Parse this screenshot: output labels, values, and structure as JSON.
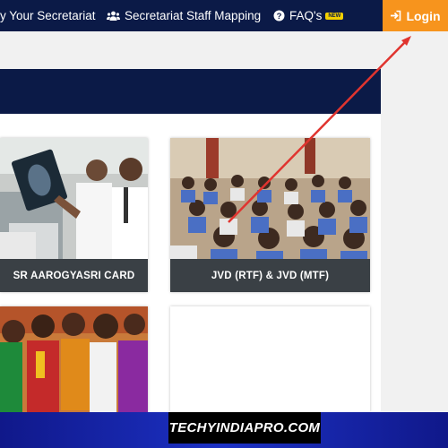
{
  "nav": {
    "item_1": "y Your Secretariat",
    "item_2": "Secretariat Staff Mapping",
    "item_3": "FAQ's",
    "item_3_badge": "NEW",
    "login": "Login"
  },
  "cards": [
    {
      "caption": "SR AAROGYASRI CARD"
    },
    {
      "caption": "JVD (RTF) & JVD (MTF)"
    },
    {
      "caption": ""
    },
    {
      "caption": ""
    }
  ],
  "watermark": "TECHYINDIAPRO.COM",
  "colors": {
    "navbar": "#0b1a47",
    "login": "#f7941d",
    "arrow": "#e0342f",
    "caption_bar": "#3a4045",
    "footer": "#1c31c4"
  },
  "icons": [
    "users-icon",
    "question-circle-icon",
    "sign-in-icon"
  ]
}
